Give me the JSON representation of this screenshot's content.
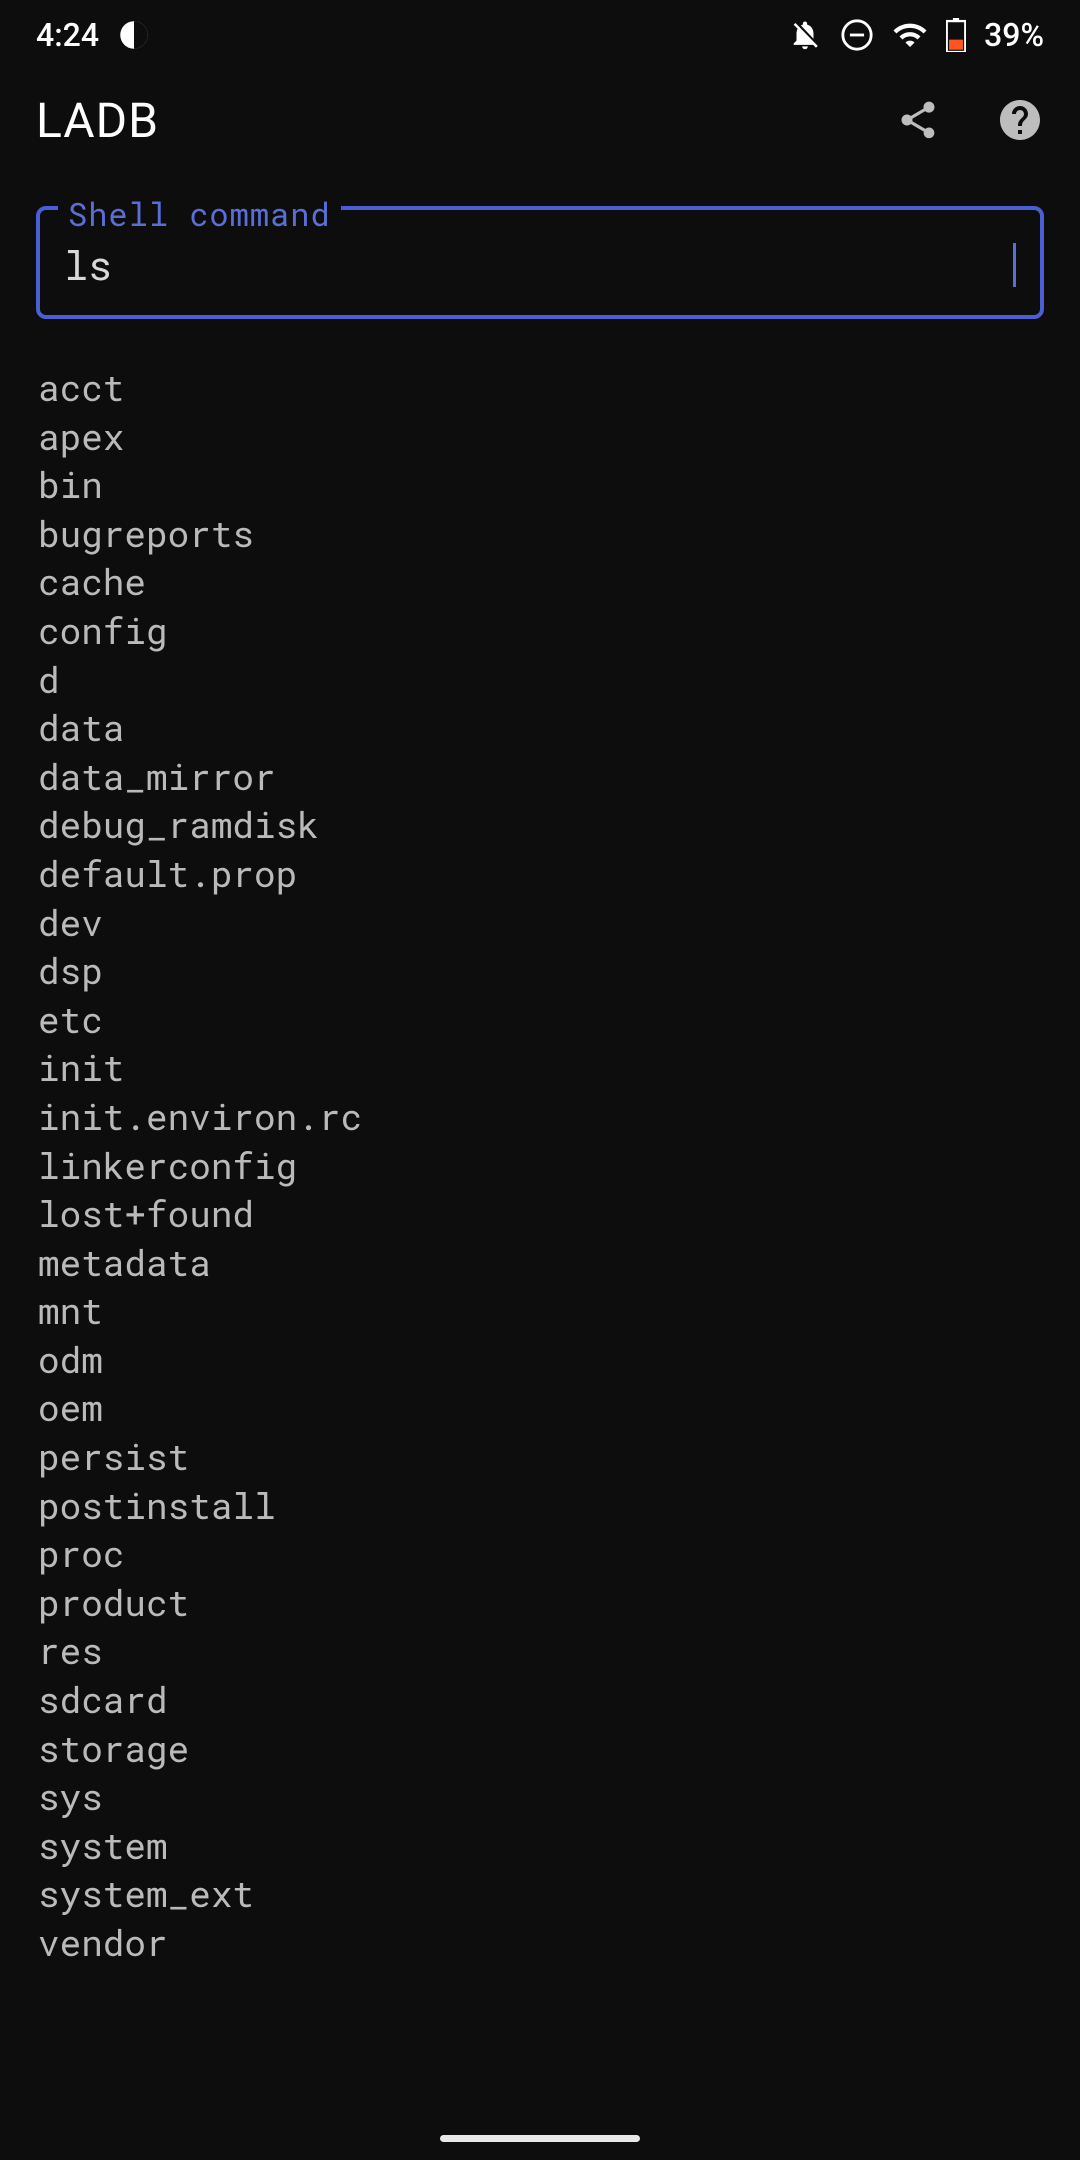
{
  "status": {
    "time": "4:24",
    "battery_percent": "39%"
  },
  "app": {
    "title": "LADB"
  },
  "shell": {
    "label": "Shell command",
    "value": "ls"
  },
  "output_lines": [
    "acct",
    "apex",
    "bin",
    "bugreports",
    "cache",
    "config",
    "d",
    "data",
    "data_mirror",
    "debug_ramdisk",
    "default.prop",
    "dev",
    "dsp",
    "etc",
    "init",
    "init.environ.rc",
    "linkerconfig",
    "lost+found",
    "metadata",
    "mnt",
    "odm",
    "oem",
    "persist",
    "postinstall",
    "proc",
    "product",
    "res",
    "sdcard",
    "storage",
    "sys",
    "system",
    "system_ext",
    "vendor"
  ]
}
